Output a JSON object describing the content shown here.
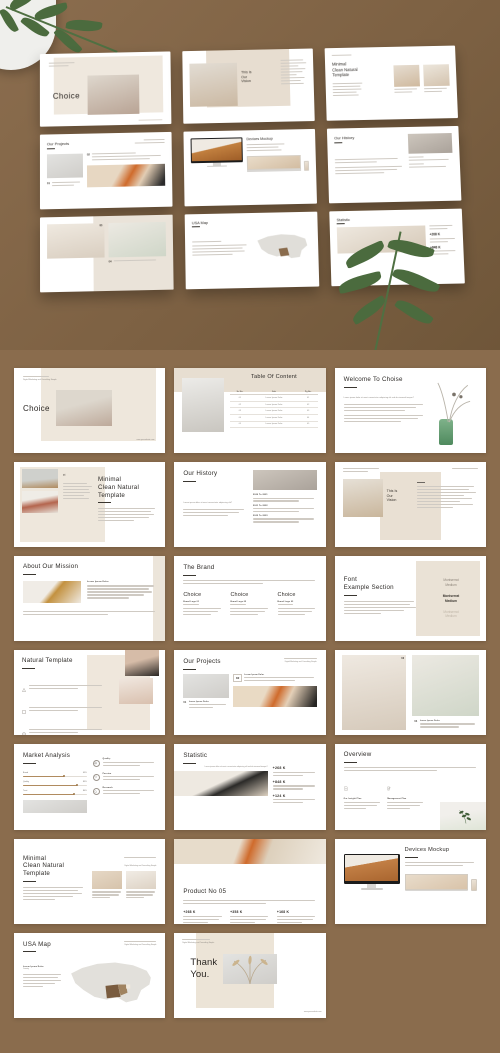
{
  "meta": {
    "background_color": "#8a6c4d",
    "slide_bg": "#ffffff",
    "accent_beige": "#e9e0d4",
    "accent_brown": "#b08b5f",
    "text_color": "#2d2a27"
  },
  "hero": {
    "slides": [
      {
        "id": "hero-cover",
        "title": "Choice",
        "kicker": "Minimal Clean Natural Template"
      },
      {
        "id": "hero-vision",
        "title": "This Is\nOur\nVision"
      },
      {
        "id": "hero-minimal",
        "title": "Minimal\nClean Natural\nTemplate"
      },
      {
        "id": "hero-projects",
        "title": "Our Projects",
        "badges": [
          "02",
          "01"
        ]
      },
      {
        "id": "hero-devices",
        "title": "Devices Mockup"
      },
      {
        "id": "hero-history",
        "title": "Our History"
      },
      {
        "id": "hero-gallery",
        "title": "",
        "badges": [
          "03",
          "04"
        ]
      },
      {
        "id": "hero-usamap",
        "title": "USA Map"
      },
      {
        "id": "hero-statistic",
        "title": "Statistic",
        "stats": [
          "+268 K",
          "+848 K"
        ]
      }
    ]
  },
  "deck": {
    "slides": [
      {
        "id": "cover",
        "layout": "cover",
        "kicker": "Minimal Clean Natural Template",
        "subkicker": "Digital Marketing and Consulting Simple",
        "title": "Choice",
        "footer": "www.yourwebsite.com"
      },
      {
        "id": "table-of-content",
        "layout": "toc",
        "title": "Table Of Content",
        "table": {
          "headers": [
            "Sr. No.",
            "Sub",
            "Pg No."
          ],
          "rows": [
            [
              "01",
              "Lorem Ipsum Dolor",
              "01"
            ],
            [
              "02",
              "Lorem Ipsum Dolor",
              "02"
            ],
            [
              "03",
              "Lorem Ipsum Dolor",
              "03"
            ],
            [
              "04",
              "Lorem Ipsum Dolor",
              "04"
            ],
            [
              "05",
              "Lorem Ipsum Dolor",
              "05"
            ]
          ]
        }
      },
      {
        "id": "welcome",
        "layout": "welcome",
        "title": "Welcome To Choise",
        "lead": "Lorem ipsum dolor sit amet consectetur adipiscing elit sed do eiusmod tempor?",
        "body": "Lorem ipsum dolor sit amet consectetur adipiscing elit sed do eiusmod tempor incididunt ut labore."
      },
      {
        "id": "quote-minimal",
        "layout": "quote",
        "quote_mark": "“",
        "quote": "Lorem ipsum dolor sit amet consectetur adipiscing elit sed do eiusmod tempor incididunt.",
        "title": "Minimal\nClean Natural\nTemplate",
        "body": "Lorem ipsum dolor sit amet consectetur adipiscing elit sed do eiusmod tempor incididunt ut labore et dolore."
      },
      {
        "id": "our-history",
        "layout": "history",
        "title": "Our History",
        "lead": "Lorem ipsum dolor sit amet consectetur adipiscing elit?",
        "body": "Lorem ipsum dolor sit amet consectetur adipiscing elit sed do eiusmod.",
        "milestones": [
          {
            "year": "2020 To 2021",
            "text": "Lorem ipsum dolor sit amet consectetur adipiscing elit sed."
          },
          {
            "year": "2021 To 2022",
            "text": "Lorem ipsum dolor sit amet consectetur adipiscing elit sed."
          },
          {
            "year": "2022 To 2023",
            "text": "Lorem ipsum dolor sit amet consectetur adipiscing elit sed."
          }
        ]
      },
      {
        "id": "our-vision",
        "layout": "vision",
        "kicker": "Minimal Clean Natural Template",
        "title": "This Is\nOur\nVision",
        "body": "Lorem ipsum dolor sit amet consectetur adipiscing elit sed do eiusmod tempor incididunt ut labore."
      },
      {
        "id": "about-our-mission",
        "layout": "mission",
        "title": "About Our Mission",
        "subtitle": "Our Mission",
        "label": "Lorem Ipsum Dolor",
        "body": "Lorem ipsum dolor sit amet consectetur adipiscing elit sed do eiusmod tempor incididunt ut labore et dolore magna aliqua.",
        "footer_body": "Lorem ipsum dolor sit amet consectetur adipiscing elit sed do eiusmod tempor incididunt ut labore et dolore magna aliqua ut enim ad minim veniam quis nostrud."
      },
      {
        "id": "the-brand",
        "layout": "brand",
        "title": "The Brand",
        "intro": "Lorem ipsum dolor sit amet consectetur adipiscing elit sed do eiusmod tempor incididunt ut labore et dolore magna aliqua ut enim ad minim.",
        "columns": [
          {
            "name": "Choice",
            "label": "Brand Logo 01",
            "text": "Lorem ipsum dolor sit amet consectetur adipiscing elit sed."
          },
          {
            "name": "Choice",
            "label": "Brand Logo 02",
            "text": "Lorem ipsum dolor sit amet consectetur adipiscing elit sed."
          },
          {
            "name": "Choice",
            "label": "Brand Logo 03",
            "text": "Lorem ipsum dolor sit amet consectetur adipiscing elit sed."
          }
        ]
      },
      {
        "id": "font-example",
        "layout": "font",
        "title": "Font\nExample Section",
        "body": "Lorem ipsum dolor sit amet consectetur adipiscing elit sed do eiusmod tempor incididunt ut labore et dolore magna aliqua.",
        "samples": [
          {
            "name": "Montserrat\nMedium",
            "weight": "light"
          },
          {
            "name": "Montserrat\nMedium",
            "weight": "bold"
          },
          {
            "name": "Montserrat\nMedium",
            "weight": "faint"
          }
        ]
      },
      {
        "id": "natural-template",
        "layout": "natural",
        "title": "Natural Template",
        "features": [
          {
            "icon": "triangle-icon",
            "text": "Lorem ipsum dolor sit amet consectetur adipiscing elit sed do."
          },
          {
            "icon": "square-icon",
            "text": "Lorem ipsum dolor sit amet consectetur adipiscing elit sed do."
          },
          {
            "icon": "circle-slash-icon",
            "text": "Lorem ipsum dolor sit amet consectetur adipiscing elit sed do."
          }
        ]
      },
      {
        "id": "our-projects",
        "layout": "projects",
        "title": "Our Projects",
        "kicker": "Minimal Clean Natural Template",
        "subkicker": "Digital Marketing and Consulting Simple",
        "items": [
          {
            "num": "02",
            "label": "Lorem Ipsum Dolor",
            "text": "Lorem ipsum dolor sit amet consectetur adipiscing elit sed do eiusmod."
          },
          {
            "num": "01",
            "label": "Lorem Ipsum Dolor",
            "text": "Lorem ipsum dolor sit amet consectetur adipiscing."
          }
        ]
      },
      {
        "id": "gallery",
        "layout": "gallery",
        "items": [
          {
            "num": "03",
            "label": "",
            "text": ""
          },
          {
            "num": "04",
            "label": "Lorem Ipsum Dolor",
            "text": "Lorem ipsum dolor sit amet consectetur adipiscing elit sed do eiusmod."
          }
        ]
      },
      {
        "id": "market-analysis",
        "layout": "market",
        "title": "Market Analysis",
        "bars": [
          {
            "label": "Brand",
            "value": "65%",
            "pct": 65
          },
          {
            "label": "Quality",
            "value": "85%",
            "pct": 85
          },
          {
            "label": "Trust",
            "value": "80%",
            "pct": 80
          }
        ],
        "features": [
          {
            "icon": "thumbs-up-icon",
            "label": "Quality",
            "text": "Lorem ipsum dolor sit amet consectetur adipiscing elit sed do eiusmod."
          },
          {
            "icon": "heart-icon",
            "label": "Passion",
            "text": "Lorem ipsum dolor sit amet consectetur adipiscing elit sed do eiusmod."
          },
          {
            "icon": "search-icon",
            "label": "Research",
            "text": "Lorem ipsum dolor sit amet consectetur adipiscing elit sed do eiusmod."
          }
        ]
      },
      {
        "id": "statistic",
        "layout": "statistic",
        "title": "Statistic",
        "lead": "Lorem ipsum dolor sit amet consectetur adipiscing elit sed do eiusmod tempor?",
        "stats": [
          {
            "value": "+268 K",
            "text": "Lorem ipsum dolor sit amet consectetur adipiscing elit sed do eiusmod tempor."
          },
          {
            "value": "+848 K",
            "text": "Lorem ipsum dolor sit amet consectetur adipiscing elit sed do eiusmod tempor."
          },
          {
            "value": "+124 K",
            "text": "Lorem ipsum dolor sit amet consectetur adipiscing elit sed do eiusmod tempor."
          }
        ]
      },
      {
        "id": "overview",
        "layout": "overview",
        "title": "Overview",
        "intro": "Lorem ipsum dolor sit amet consectetur adipiscing elit sed do eiusmod tempor incididunt ut labore et dolore magna aliqua ut enim ad minim veniam quis nostrud exercitation.",
        "features": [
          {
            "icon": "document-icon",
            "label": "Our Insight Plan",
            "text": "Lorem ipsum dolor sit amet consectetur adipiscing elit sed do."
          },
          {
            "icon": "edit-icon",
            "label": "Management Plan",
            "text": "Lorem ipsum dolor sit amet consectetur adipiscing elit sed do."
          }
        ]
      },
      {
        "id": "minimal-clean",
        "layout": "minimal",
        "title": "Minimal\nClean Natural\nTemplate",
        "kicker": "Minimal Clean Natural Template",
        "subkicker": "Digital Marketing and Consulting Simple",
        "body": "Lorem ipsum dolor sit amet consectetur adipiscing elit sed do eiusmod tempor incididunt ut labore et dolore magna aliqua.",
        "captions": [
          "Lorem ipsum dolor sit amet consectetur adipiscing elit sed do eiusmod.",
          "Lorem ipsum dolor sit amet consectetur adipiscing elit sed do eiusmod."
        ]
      },
      {
        "id": "product-no-05",
        "layout": "product",
        "title": "Product No 05",
        "intro": "Lorem ipsum dolor sit amet consectetur adipiscing elit sed do eiusmod tempor incididunt ut labore et dolore magna aliqua ut enim ad minim veniam quis.",
        "stats": [
          {
            "value": "+268 K",
            "text": "Lorem ipsum dolor sit amet consectetur adipiscing elit sed do eiusmod tempor incididunt."
          },
          {
            "value": "+358 K",
            "text": "Lorem ipsum dolor sit amet consectetur adipiscing elit sed do eiusmod tempor incididunt."
          },
          {
            "value": "+168 K",
            "text": "Lorem ipsum dolor sit amet consectetur adipiscing elit sed do eiusmod tempor incididunt."
          }
        ]
      },
      {
        "id": "devices-mockup",
        "layout": "devices",
        "title": "Devices Mockup",
        "body": "Lorem ipsum dolor sit amet consectetur adipiscing elit sed do eiusmod tempor incididunt ut labore."
      },
      {
        "id": "usa-map",
        "layout": "usamap",
        "title": "USA Map",
        "kicker": "Minimal Clean Natural Template",
        "subkicker": "Digital Marketing and Consulting Simple",
        "label": "Lorem Ipsum Dolor",
        "sublabel": "Country",
        "body": "Lorem ipsum dolor sit amet consectetur adipiscing elit sed do eiusmod tempor incididunt ut labore et dolore magna aliqua ut enim."
      },
      {
        "id": "thank-you",
        "layout": "thanks",
        "kicker": "Minimal Clean Natural Template",
        "subkicker": "Digital Marketing and Consulting Simple",
        "title": "Thank\nYou.",
        "footer": "www.yourwebsite.com"
      }
    ]
  }
}
